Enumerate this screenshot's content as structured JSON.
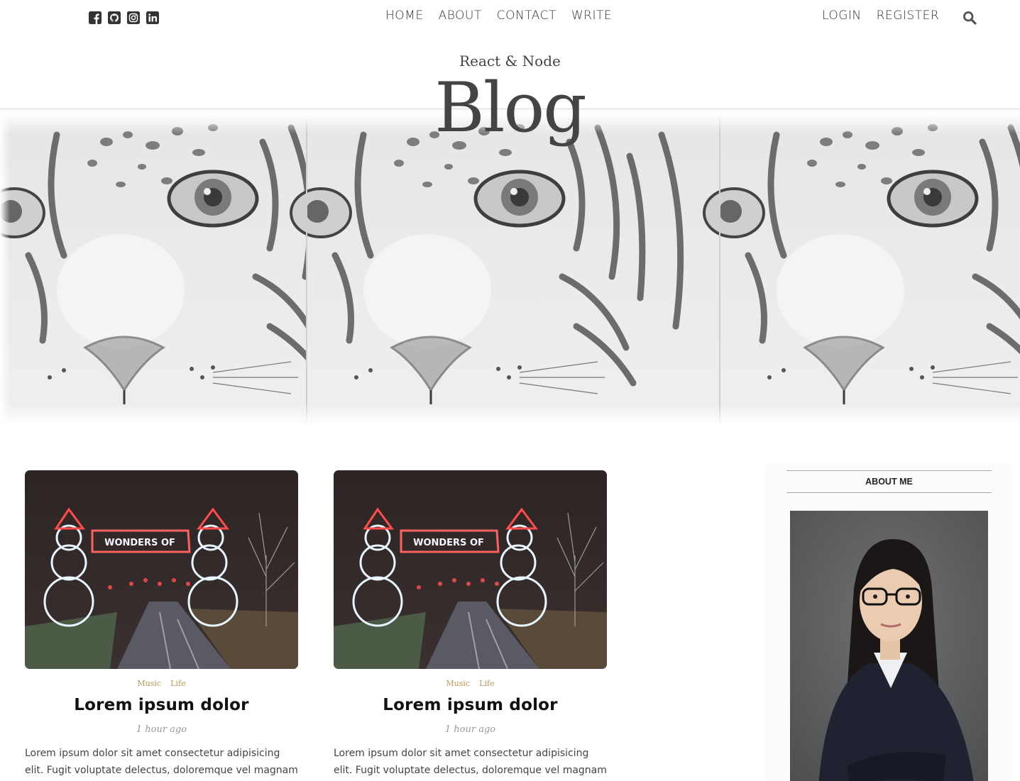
{
  "social": {
    "icons": [
      "facebook-icon",
      "github-icon",
      "instagram-icon",
      "linkedin-icon"
    ]
  },
  "nav": {
    "items": [
      "HOME",
      "ABOUT",
      "CONTACT",
      "WRITE"
    ]
  },
  "auth": {
    "login": "LOGIN",
    "register": "REGISTER"
  },
  "header": {
    "subtitle": "React & Node",
    "title": "Blog"
  },
  "posts": [
    {
      "categories": [
        "Music",
        "Life"
      ],
      "title": "Lorem ipsum dolor",
      "date": "1 hour ago",
      "desc": "Lorem ipsum dolor sit amet consectetur adipisicing elit. Fugit voluptate delectus, doloremque vel magnam libero"
    },
    {
      "categories": [
        "Music",
        "Life"
      ],
      "title": "Lorem ipsum dolor",
      "date": "1 hour ago",
      "desc": "Lorem ipsum dolor sit amet consectetur adipisicing elit. Fugit voluptate delectus, doloremque vel magnam libero"
    }
  ],
  "sidebar": {
    "title": "ABOUT ME"
  },
  "colors": {
    "category": "#be9656",
    "text": "#444444"
  }
}
